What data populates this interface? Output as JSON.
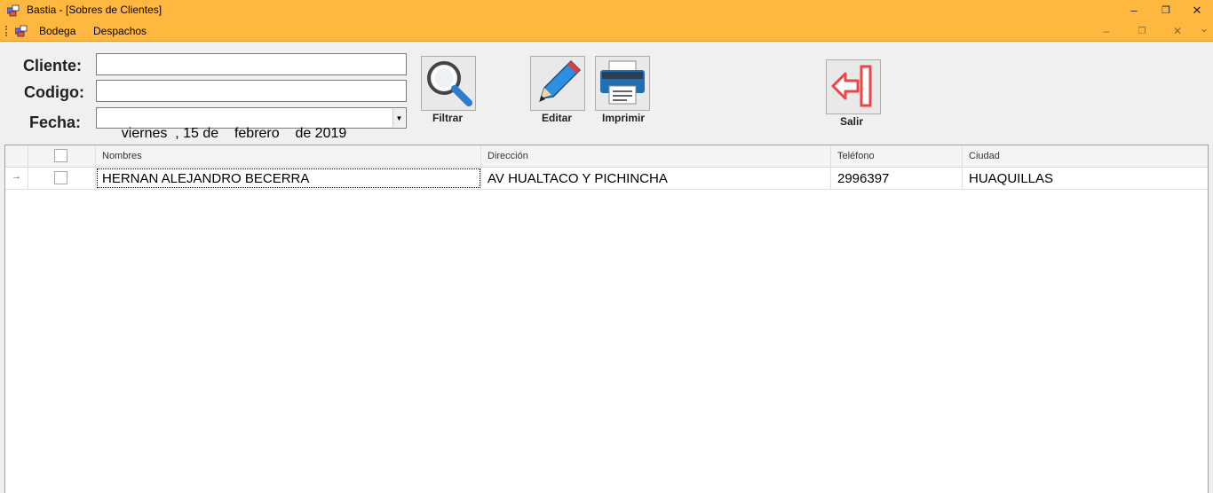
{
  "window": {
    "title": "Bastia - [Sobres de Clientes]",
    "controls": {
      "minimize": "–",
      "restore": "❐",
      "close": "✕"
    }
  },
  "menu": {
    "items": [
      "Bodega",
      "Despachos"
    ],
    "mdi_controls": {
      "minimize": "–",
      "restore": "❐",
      "close": "✕",
      "dropdown": "⌄"
    }
  },
  "form": {
    "cliente_label": "Cliente:",
    "cliente_value": "",
    "codigo_label": "Codigo:",
    "codigo_value": "",
    "fecha_label": "Fecha:",
    "fecha_value": "viernes  , 15 de    febrero    de 2019"
  },
  "toolbar": {
    "filtrar": "Filtrar",
    "editar": "Editar",
    "imprimir": "Imprimir",
    "salir": "Salir"
  },
  "grid": {
    "columns": [
      "Nombres",
      "Dirección",
      "Teléfono",
      "Ciudad"
    ],
    "rows": [
      {
        "indicator": "→",
        "checked": false,
        "nombres": "HERNAN ALEJANDRO BECERRA",
        "direccion": "AV HUALTACO Y PICHINCHA",
        "telefono": "2996397",
        "ciudad": "HUAQUILLAS"
      }
    ]
  },
  "colors": {
    "titlebar": "#ffb83f",
    "background": "#f0f0f0"
  }
}
